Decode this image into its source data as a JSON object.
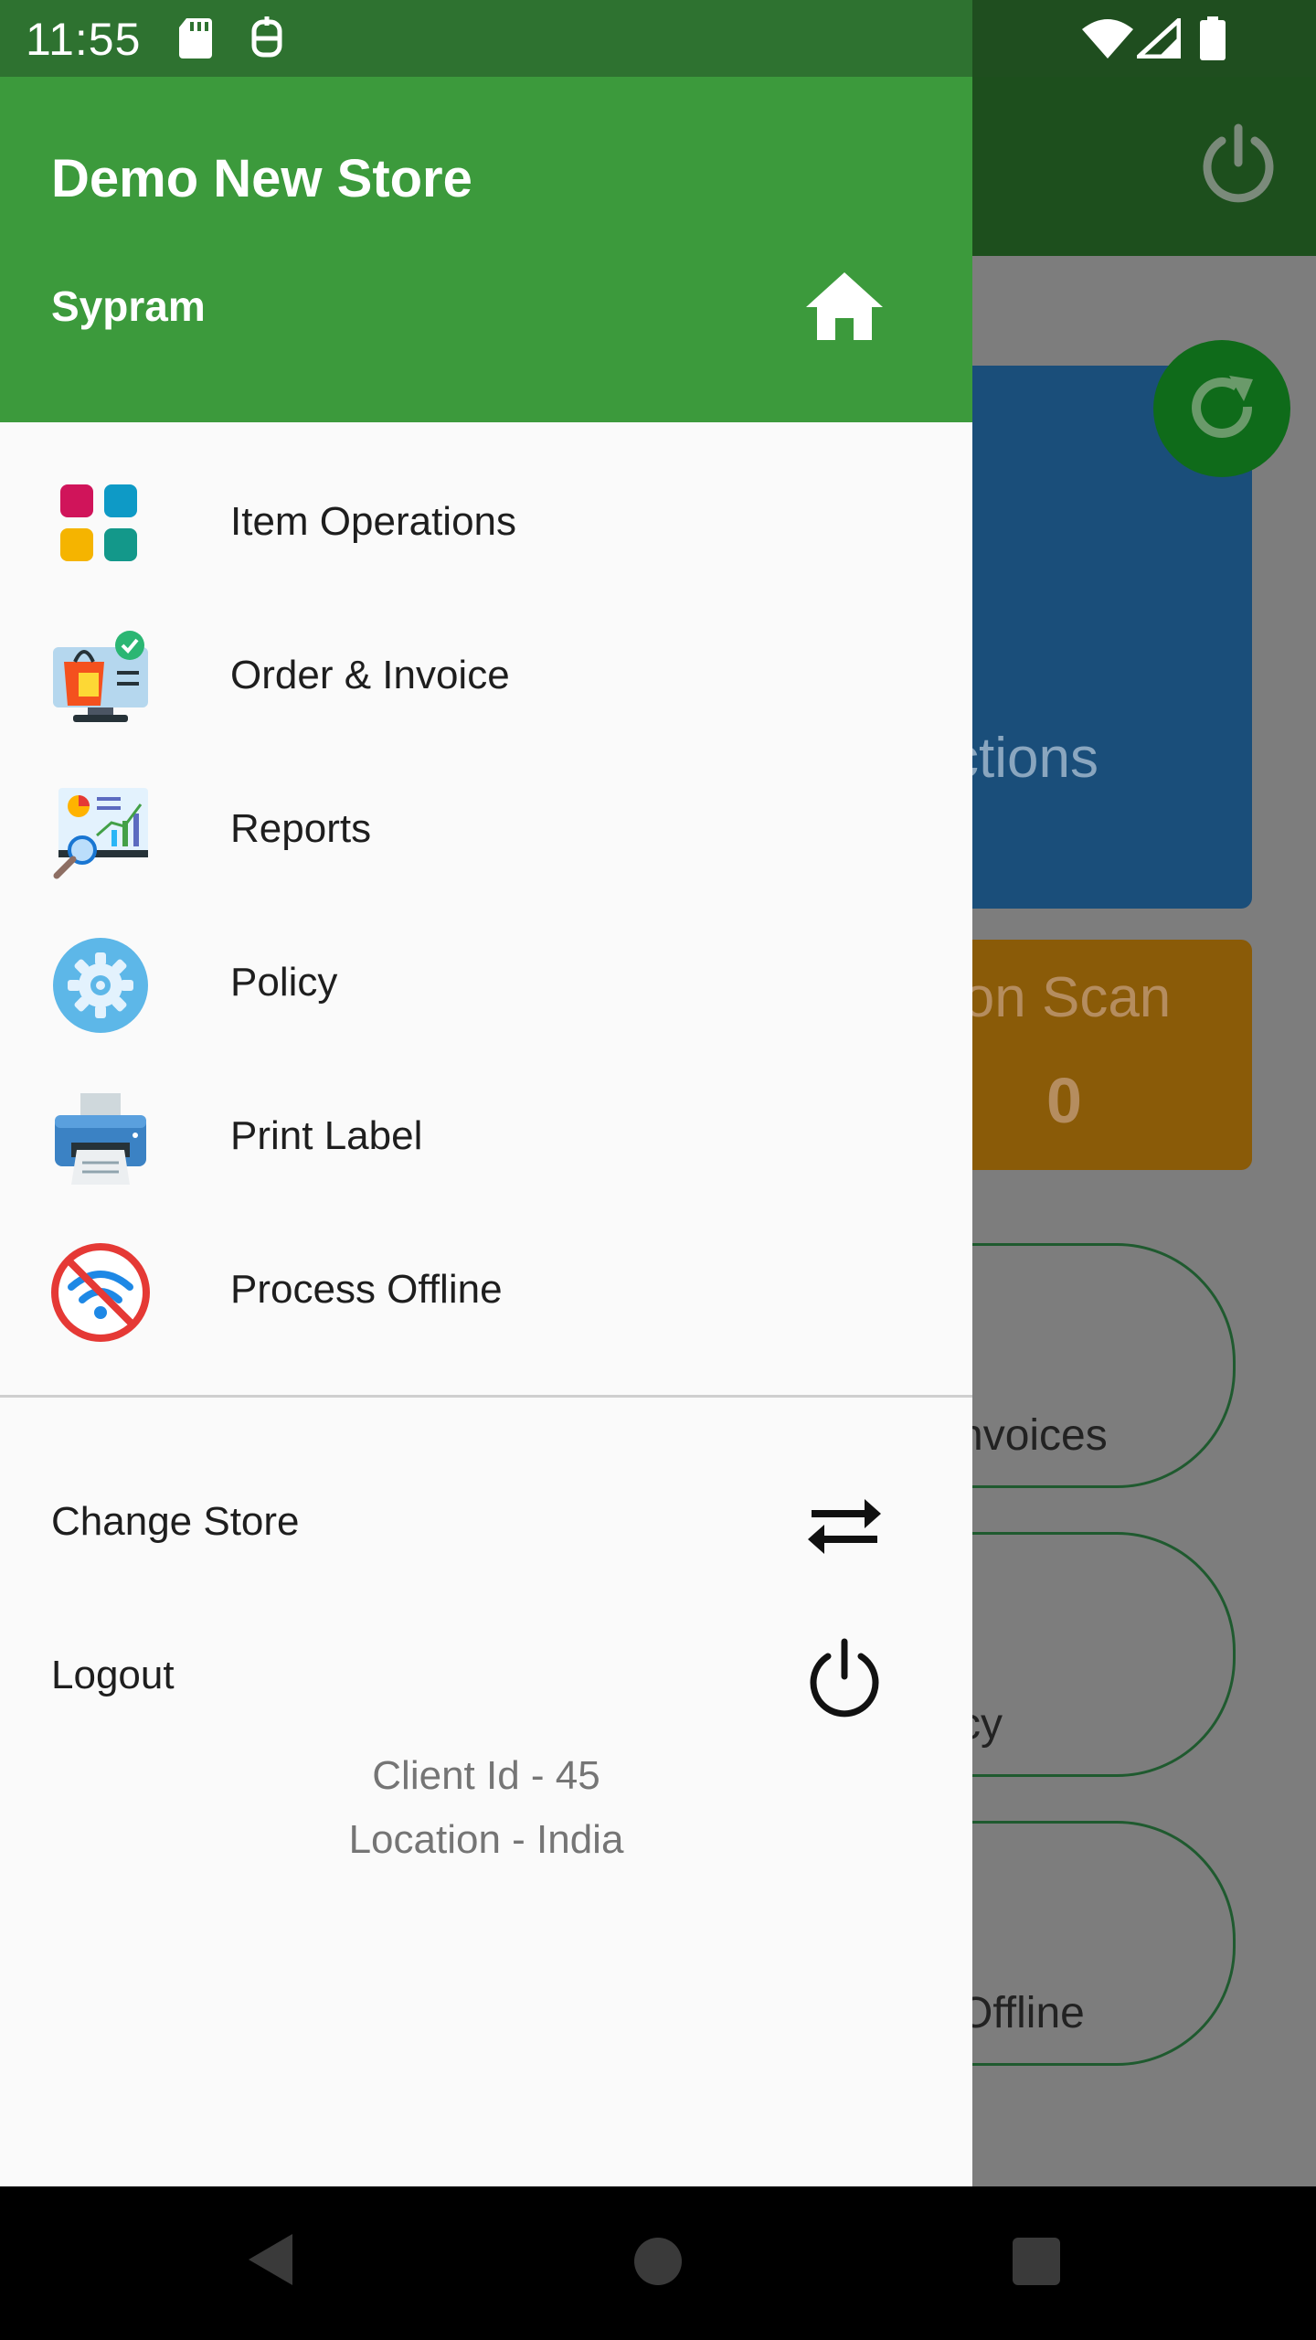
{
  "status_bar": {
    "time": "11:55"
  },
  "drawer": {
    "store_name": "Demo New Store",
    "user_name": "Sypram",
    "menu_items": [
      {
        "label": "Item Operations",
        "icon": "grid-apps-icon"
      },
      {
        "label": "Order & Invoice",
        "icon": "shopping-order-icon"
      },
      {
        "label": "Reports",
        "icon": "reports-analytics-icon"
      },
      {
        "label": "Policy",
        "icon": "gear-icon"
      },
      {
        "label": "Print Label",
        "icon": "printer-icon"
      },
      {
        "label": "Process Offline",
        "icon": "no-wifi-icon"
      }
    ],
    "change_store_label": "Change Store",
    "logout_label": "Logout",
    "client_id": "Client Id - 45",
    "location": "Location - India"
  },
  "background": {
    "blue_card_text": "ctions",
    "orange_card_text": "lon Scan",
    "orange_card_value": "0",
    "pill1_text": "nvoices",
    "pill2_text": "cy",
    "pill3_text": "Offline"
  },
  "colors": {
    "header_green": "#3c9a3c",
    "drawer_bg": "#fafafa",
    "status_bar": "#2e7230"
  }
}
